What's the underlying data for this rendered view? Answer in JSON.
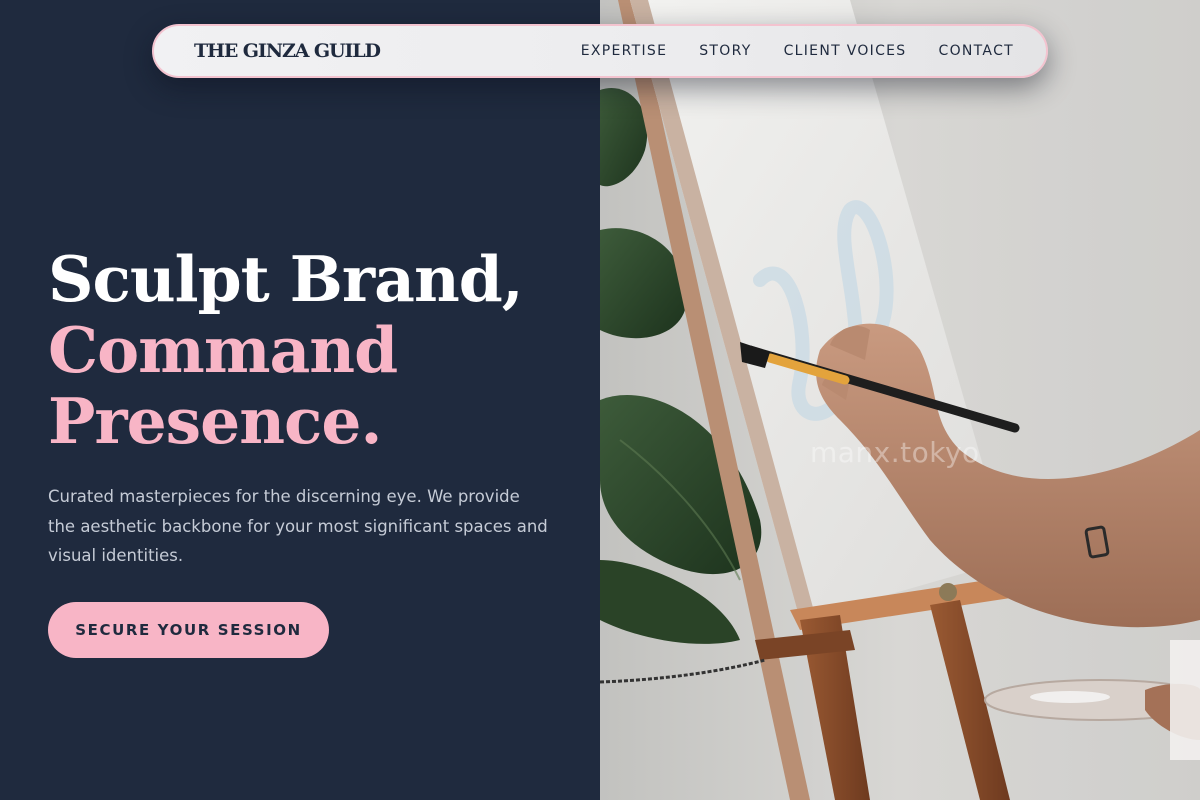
{
  "nav": {
    "brand": "THE GINZA GUILD",
    "links": [
      "EXPERTISE",
      "STORY",
      "CLIENT VOICES",
      "CONTACT"
    ]
  },
  "hero": {
    "title_line1": "Sculpt Brand,",
    "title_line2": "Command",
    "title_line3": "Presence.",
    "description": "Curated masterpieces for the discerning eye. We provide the aesthetic backbone for your most significant spaces and visual identities.",
    "cta_label": "SECURE YOUR SESSION"
  },
  "image": {
    "subject": "painter-at-easel",
    "watermark": "manx.tokyo"
  },
  "colors": {
    "navy": "#1f2a3e",
    "pink_accent": "#f8b5c6",
    "nav_background": "#efeff1",
    "body_text": "#c5cbd6"
  }
}
